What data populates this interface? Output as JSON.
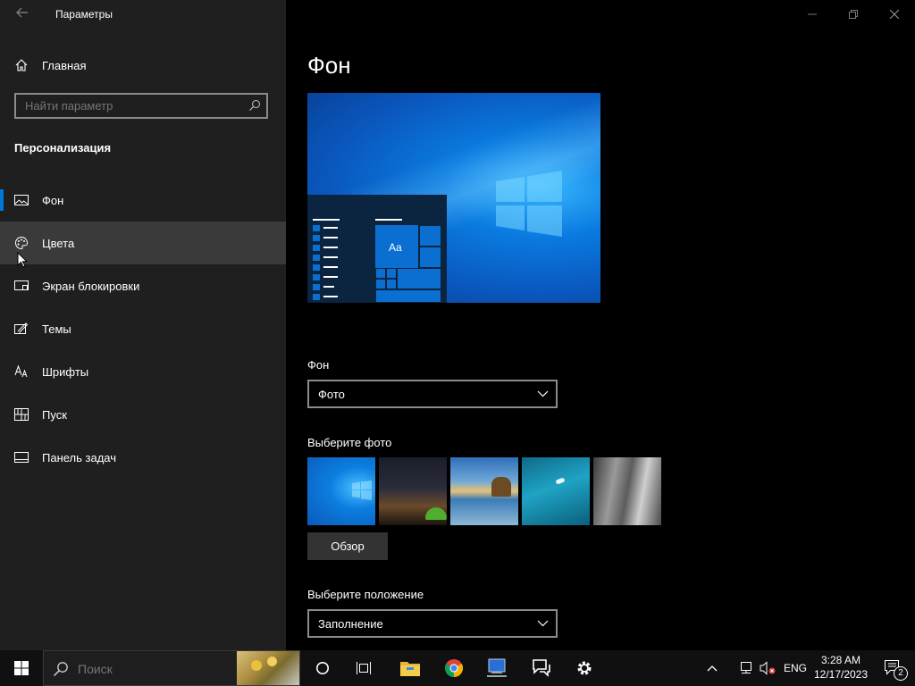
{
  "window": {
    "title": "Параметры"
  },
  "sidebar": {
    "home_label": "Главная",
    "search_placeholder": "Найти параметр",
    "section_title": "Персонализация",
    "items": [
      {
        "label": "Фон",
        "icon": "picture-icon"
      },
      {
        "label": "Цвета",
        "icon": "palette-icon"
      },
      {
        "label": "Экран блокировки",
        "icon": "lock-screen-icon"
      },
      {
        "label": "Темы",
        "icon": "themes-icon"
      },
      {
        "label": "Шрифты",
        "icon": "fonts-icon"
      },
      {
        "label": "Пуск",
        "icon": "start-icon"
      },
      {
        "label": "Панель задач",
        "icon": "taskbar-icon"
      }
    ]
  },
  "main": {
    "title": "Фон",
    "preview": {
      "tile_text": "Aa"
    },
    "background_label": "Фон",
    "background_value": "Фото",
    "choose_photo_label": "Выберите фото",
    "browse_label": "Обзор",
    "position_label": "Выберите положение",
    "position_value": "Заполнение"
  },
  "taskbar": {
    "search_placeholder": "Поиск",
    "language": "ENG",
    "time": "3:28 AM",
    "date": "12/17/2023",
    "notification_count": "2"
  },
  "colors": {
    "accent": "#0078d7",
    "sidebar_bg": "#1f1f1f",
    "hover_bg": "#3a3a3a"
  }
}
